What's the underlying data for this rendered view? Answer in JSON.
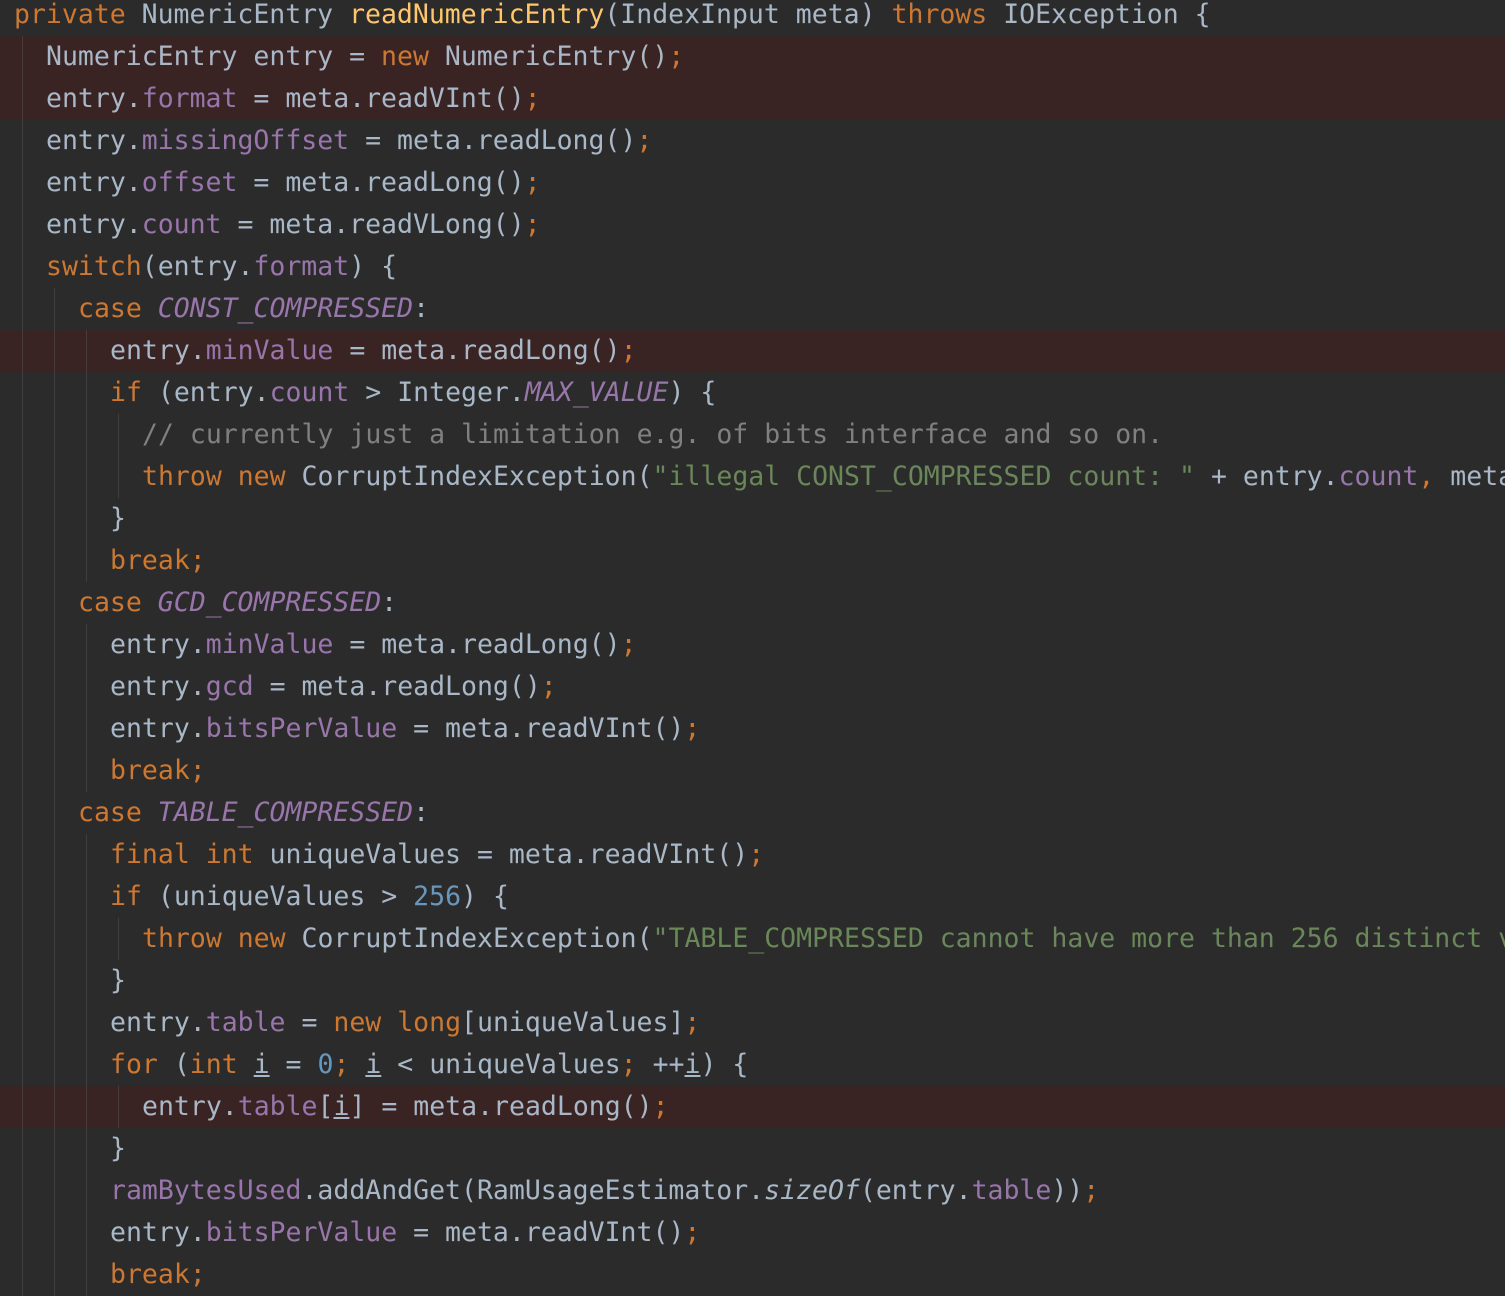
{
  "editor": {
    "colors": {
      "background": "#2b2b2b",
      "breakpoint_line": "#3a2323",
      "keyword": "#cc7832",
      "method_declaration": "#ffc66d",
      "field": "#9876aa",
      "string": "#6a8759",
      "number": "#6897bb",
      "comment": "#808080",
      "default": "#a9b7c6"
    },
    "lines": [
      {
        "indent": 0,
        "breakpoint": false,
        "tokens": [
          [
            "kw",
            "private "
          ],
          [
            "",
            "NumericEntry "
          ],
          [
            "fn",
            "readNumericEntry"
          ],
          [
            "",
            "(IndexInput meta) "
          ],
          [
            "kw",
            "throws "
          ],
          [
            "",
            "IOException {"
          ]
        ]
      },
      {
        "indent": 1,
        "breakpoint": true,
        "tokens": [
          [
            "",
            "NumericEntry entry = "
          ],
          [
            "kw",
            "new "
          ],
          [
            "",
            "NumericEntry()"
          ],
          [
            "kw",
            ";"
          ]
        ]
      },
      {
        "indent": 1,
        "breakpoint": true,
        "tokens": [
          [
            "",
            "entry."
          ],
          [
            "fld",
            "format"
          ],
          [
            "",
            " = meta.readVInt()"
          ],
          [
            "kw",
            ";"
          ]
        ]
      },
      {
        "indent": 1,
        "breakpoint": false,
        "tokens": [
          [
            "",
            "entry."
          ],
          [
            "fld",
            "missingOffset"
          ],
          [
            "",
            " = meta.readLong()"
          ],
          [
            "kw",
            ";"
          ]
        ]
      },
      {
        "indent": 1,
        "breakpoint": false,
        "tokens": [
          [
            "",
            "entry."
          ],
          [
            "fld",
            "offset"
          ],
          [
            "",
            " = meta.readLong()"
          ],
          [
            "kw",
            ";"
          ]
        ]
      },
      {
        "indent": 1,
        "breakpoint": false,
        "tokens": [
          [
            "",
            "entry."
          ],
          [
            "fld",
            "count"
          ],
          [
            "",
            " = meta.readVLong()"
          ],
          [
            "kw",
            ";"
          ]
        ]
      },
      {
        "indent": 1,
        "breakpoint": false,
        "tokens": [
          [
            "kw",
            "switch"
          ],
          [
            "",
            "(entry."
          ],
          [
            "fld",
            "format"
          ],
          [
            "",
            ") {"
          ]
        ]
      },
      {
        "indent": 2,
        "breakpoint": false,
        "tokens": [
          [
            "kw",
            "case "
          ],
          [
            "cst",
            "CONST_COMPRESSED"
          ],
          [
            "",
            ":"
          ]
        ]
      },
      {
        "indent": 3,
        "breakpoint": true,
        "tokens": [
          [
            "",
            "entry."
          ],
          [
            "fld",
            "minValue"
          ],
          [
            "",
            " = meta.readLong()"
          ],
          [
            "kw",
            ";"
          ]
        ]
      },
      {
        "indent": 3,
        "breakpoint": false,
        "tokens": [
          [
            "kw",
            "if "
          ],
          [
            "",
            "(entry."
          ],
          [
            "fld",
            "count"
          ],
          [
            "",
            " > Integer."
          ],
          [
            "cst",
            "MAX_VALUE"
          ],
          [
            "",
            ") {"
          ]
        ]
      },
      {
        "indent": 4,
        "breakpoint": false,
        "tokens": [
          [
            "cmt",
            "// currently just a limitation e.g. of bits interface and so on."
          ]
        ]
      },
      {
        "indent": 4,
        "breakpoint": false,
        "tokens": [
          [
            "kw",
            "throw new "
          ],
          [
            "",
            "CorruptIndexException("
          ],
          [
            "str",
            "\"illegal CONST_COMPRESSED count: \""
          ],
          [
            "",
            " + entry."
          ],
          [
            "fld",
            "count"
          ],
          [
            "kw",
            ", "
          ],
          [
            "",
            "meta"
          ]
        ]
      },
      {
        "indent": 3,
        "breakpoint": false,
        "tokens": [
          [
            "",
            "}"
          ]
        ]
      },
      {
        "indent": 3,
        "breakpoint": false,
        "tokens": [
          [
            "kw",
            "break;"
          ]
        ]
      },
      {
        "indent": 2,
        "breakpoint": false,
        "tokens": [
          [
            "kw",
            "case "
          ],
          [
            "cst",
            "GCD_COMPRESSED"
          ],
          [
            "",
            ":"
          ]
        ]
      },
      {
        "indent": 3,
        "breakpoint": false,
        "tokens": [
          [
            "",
            "entry."
          ],
          [
            "fld",
            "minValue"
          ],
          [
            "",
            " = meta.readLong()"
          ],
          [
            "kw",
            ";"
          ]
        ]
      },
      {
        "indent": 3,
        "breakpoint": false,
        "tokens": [
          [
            "",
            "entry."
          ],
          [
            "fld",
            "gcd"
          ],
          [
            "",
            " = meta.readLong()"
          ],
          [
            "kw",
            ";"
          ]
        ]
      },
      {
        "indent": 3,
        "breakpoint": false,
        "tokens": [
          [
            "",
            "entry."
          ],
          [
            "fld",
            "bitsPerValue"
          ],
          [
            "",
            " = meta.readVInt()"
          ],
          [
            "kw",
            ";"
          ]
        ]
      },
      {
        "indent": 3,
        "breakpoint": false,
        "tokens": [
          [
            "kw",
            "break;"
          ]
        ]
      },
      {
        "indent": 2,
        "breakpoint": false,
        "tokens": [
          [
            "kw",
            "case "
          ],
          [
            "cst",
            "TABLE_COMPRESSED"
          ],
          [
            "",
            ":"
          ]
        ]
      },
      {
        "indent": 3,
        "breakpoint": false,
        "tokens": [
          [
            "kw",
            "final int "
          ],
          [
            "",
            "uniqueValues = meta.readVInt()"
          ],
          [
            "kw",
            ";"
          ]
        ]
      },
      {
        "indent": 3,
        "breakpoint": false,
        "tokens": [
          [
            "kw",
            "if "
          ],
          [
            "",
            "(uniqueValues > "
          ],
          [
            "num",
            "256"
          ],
          [
            "",
            ") {"
          ]
        ]
      },
      {
        "indent": 4,
        "breakpoint": false,
        "tokens": [
          [
            "kw",
            "throw new "
          ],
          [
            "",
            "CorruptIndexException("
          ],
          [
            "str",
            "\"TABLE_COMPRESSED cannot have more than 256 distinct v"
          ]
        ]
      },
      {
        "indent": 3,
        "breakpoint": false,
        "tokens": [
          [
            "",
            "}"
          ]
        ]
      },
      {
        "indent": 3,
        "breakpoint": false,
        "tokens": [
          [
            "",
            "entry."
          ],
          [
            "fld",
            "table"
          ],
          [
            "",
            " = "
          ],
          [
            "kw",
            "new long"
          ],
          [
            "",
            "[uniqueValues]"
          ],
          [
            "kw",
            ";"
          ]
        ]
      },
      {
        "indent": 3,
        "breakpoint": false,
        "tokens": [
          [
            "kw",
            "for "
          ],
          [
            "",
            "("
          ],
          [
            "kw",
            "int "
          ],
          [
            "u",
            "i"
          ],
          [
            "",
            " = "
          ],
          [
            "num",
            "0"
          ],
          [
            "kw",
            "; "
          ],
          [
            "u",
            "i"
          ],
          [
            "",
            " < uniqueValues"
          ],
          [
            "kw",
            "; "
          ],
          [
            "",
            "++"
          ],
          [
            "u",
            "i"
          ],
          [
            "",
            ") {"
          ]
        ]
      },
      {
        "indent": 4,
        "breakpoint": true,
        "tokens": [
          [
            "",
            "entry."
          ],
          [
            "fld",
            "table"
          ],
          [
            "",
            "["
          ],
          [
            "u",
            "i"
          ],
          [
            "",
            "] = meta.readLong()"
          ],
          [
            "kw",
            ";"
          ]
        ]
      },
      {
        "indent": 3,
        "breakpoint": false,
        "tokens": [
          [
            "",
            "}"
          ]
        ]
      },
      {
        "indent": 3,
        "breakpoint": false,
        "tokens": [
          [
            "fld",
            "ramBytesUsed"
          ],
          [
            "",
            ".addAndGet(RamUsageEstimator."
          ],
          [
            "it",
            "sizeOf"
          ],
          [
            "",
            "(entry."
          ],
          [
            "fld",
            "table"
          ],
          [
            "",
            "))"
          ],
          [
            "kw",
            ";"
          ]
        ]
      },
      {
        "indent": 3,
        "breakpoint": false,
        "tokens": [
          [
            "",
            "entry."
          ],
          [
            "fld",
            "bitsPerValue"
          ],
          [
            "",
            " = meta.readVInt()"
          ],
          [
            "kw",
            ";"
          ]
        ]
      },
      {
        "indent": 3,
        "breakpoint": false,
        "tokens": [
          [
            "kw",
            "break;"
          ]
        ]
      }
    ]
  }
}
